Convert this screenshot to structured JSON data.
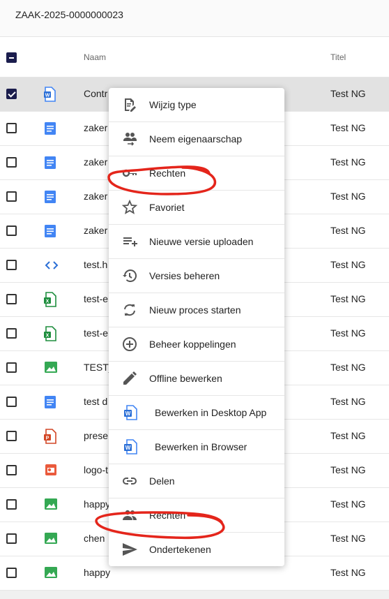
{
  "header": {
    "case_title": "ZAAK-2025-0000000023"
  },
  "table": {
    "columns": {
      "name": "Naam",
      "title": "Titel"
    },
    "rows": [
      {
        "name": "Contr",
        "title": "Test NG",
        "icon": "word-doc-icon",
        "selected": true
      },
      {
        "name": "zaker",
        "title": "Test NG",
        "icon": "document-icon",
        "selected": false
      },
      {
        "name": "zaker",
        "title": "Test NG",
        "icon": "document-icon",
        "selected": false
      },
      {
        "name": "zaker",
        "title": "Test NG",
        "icon": "document-icon",
        "selected": false
      },
      {
        "name": "zaker",
        "title": "Test NG",
        "icon": "document-icon",
        "selected": false
      },
      {
        "name": "test.h",
        "title": "Test NG",
        "icon": "code-icon",
        "selected": false
      },
      {
        "name": "test-e",
        "title": "Test NG",
        "icon": "excel-icon",
        "selected": false
      },
      {
        "name": "test-e",
        "title": "Test NG",
        "icon": "excel-icon",
        "selected": false
      },
      {
        "name": "TEST_",
        "title": "Test NG",
        "icon": "image-icon",
        "selected": false
      },
      {
        "name": "test d",
        "title": "Test NG",
        "icon": "document-icon",
        "selected": false
      },
      {
        "name": "prese",
        "title": "Test NG",
        "icon": "powerpoint-icon",
        "selected": false
      },
      {
        "name": "logo-t",
        "title": "Test NG",
        "icon": "slides-icon",
        "selected": false
      },
      {
        "name": "happy",
        "title": "Test NG",
        "icon": "image-icon",
        "selected": false
      },
      {
        "name": "chen",
        "title": "Test NG",
        "icon": "image-icon",
        "selected": false
      },
      {
        "name": "happy",
        "title": "Test NG",
        "icon": "image-icon",
        "selected": false
      }
    ]
  },
  "context_menu": {
    "items": [
      {
        "label": "Wijzig type",
        "icon": "edit-document-icon"
      },
      {
        "label": "Neem eigenaarschap",
        "icon": "transfer-ownership-icon"
      },
      {
        "label": "Rechten",
        "icon": "key-icon"
      },
      {
        "label": "Favoriet",
        "icon": "star-icon"
      },
      {
        "label": "Nieuwe versie uploaden",
        "icon": "playlist-add-icon"
      },
      {
        "label": "Versies beheren",
        "icon": "history-icon"
      },
      {
        "label": "Nieuw proces starten",
        "icon": "sync-icon"
      },
      {
        "label": "Beheer koppelingen",
        "icon": "add-circle-icon"
      },
      {
        "label": "Offline bewerken",
        "icon": "pencil-icon"
      },
      {
        "label": "Bewerken in Desktop App",
        "icon": "word-doc-icon"
      },
      {
        "label": "Bewerken in Browser",
        "icon": "word-doc-icon"
      },
      {
        "label": "Delen",
        "icon": "link-icon"
      },
      {
        "label": "Rechten",
        "icon": "people-icon"
      },
      {
        "label": "Ondertekenen",
        "icon": "send-icon"
      }
    ]
  },
  "colors": {
    "accent": "#1b1d4d",
    "annotation": "#e4251b",
    "doc_blue": "#4285f4",
    "excel_green": "#1e8e3e",
    "ppt_red": "#d24726",
    "image_green": "#34a853"
  }
}
